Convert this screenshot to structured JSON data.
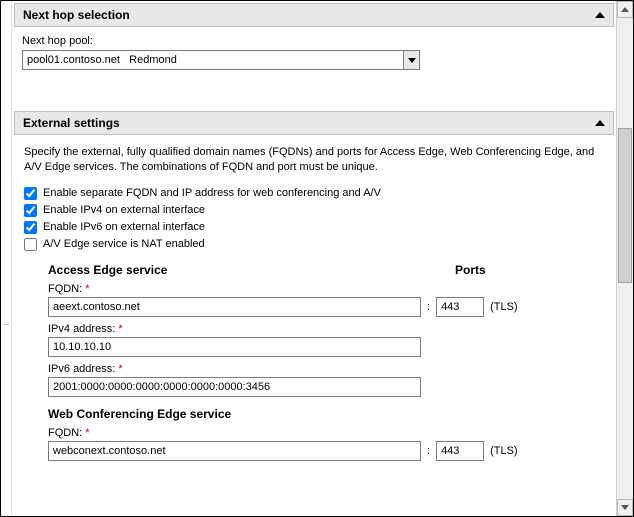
{
  "sections": {
    "nextHop": {
      "title": "Next hop selection",
      "poolLabel": "Next hop pool:",
      "poolValue": "pool01.contoso.net   Redmond"
    },
    "external": {
      "title": "External settings",
      "description": "Specify the external, fully qualified domain names (FQDNs) and ports for Access Edge, Web Conferencing Edge, and A/V Edge services. The combinations of FQDN and port must be unique.",
      "checks": {
        "separateFqdn": "Enable separate FQDN and IP address for web conferencing and A/V",
        "ipv4": "Enable IPv4 on external interface",
        "ipv6": "Enable IPv6 on external interface",
        "nat": "A/V Edge service is NAT enabled"
      },
      "portsHeader": "Ports",
      "accessEdge": {
        "title": "Access Edge service",
        "fqdnLabel": "FQDN:",
        "fqdnValue": "aeext.contoso.net",
        "port": "443",
        "protocol": "(TLS)",
        "ipv4Label": "IPv4 address:",
        "ipv4Value": "10.10.10.10",
        "ipv6Label": "IPv6 address:",
        "ipv6Value": "2001:0000:0000:0000:0000:0000:0000:3456"
      },
      "webConf": {
        "title": "Web Conferencing Edge service",
        "fqdnLabel": "FQDN:",
        "fqdnValue": "webconext.contoso.net",
        "port": "443",
        "protocol": "(TLS)"
      },
      "required": "*"
    }
  }
}
